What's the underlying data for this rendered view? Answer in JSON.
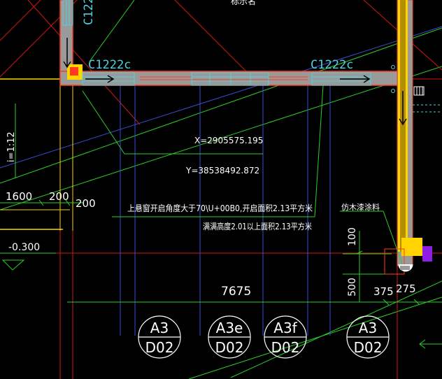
{
  "colors": {
    "background": "#000000",
    "wall_fill": "#9a9a9a",
    "wall_stroke": "#ff3b1f",
    "window": "#4fd1e0",
    "column": "#ffd400",
    "axis_red": "#d01818",
    "green": "#2ad12a",
    "blue": "#3a4cd6",
    "white": "#ffffff",
    "magenta": "#8c1ee6"
  },
  "labels": {
    "top_cut": "标示名",
    "window_left_vertical": "C122",
    "window_left": "C1222c",
    "window_right": "C1222c",
    "coord_x": "X=2905575.195",
    "coord_y": "Y=38538492.872",
    "note_line1": "上悬窗开启角度大于70\\U+00B0,开启面积2.13平方米",
    "note_line2": "满满高度2.01以上面积2.13平方米",
    "note_right": "仿木漆涂料",
    "slope": "i=1:12",
    "elev": "-0.300",
    "dim_1600": "1600",
    "dim_200a": "200",
    "dim_200b": "200",
    "dim_7675": "7675",
    "dim_100": "100",
    "dim_500": "500",
    "dim_375": "375",
    "dim_275": "275",
    "bubble1_top": "A3",
    "bubble1_bottom": "D02",
    "bubble2_top": "A3e",
    "bubble2_bottom": "D02",
    "bubble3_top": "A3f",
    "bubble3_bottom": "D02",
    "bubble4_top": "A3",
    "bubble4_bottom": "D02"
  }
}
